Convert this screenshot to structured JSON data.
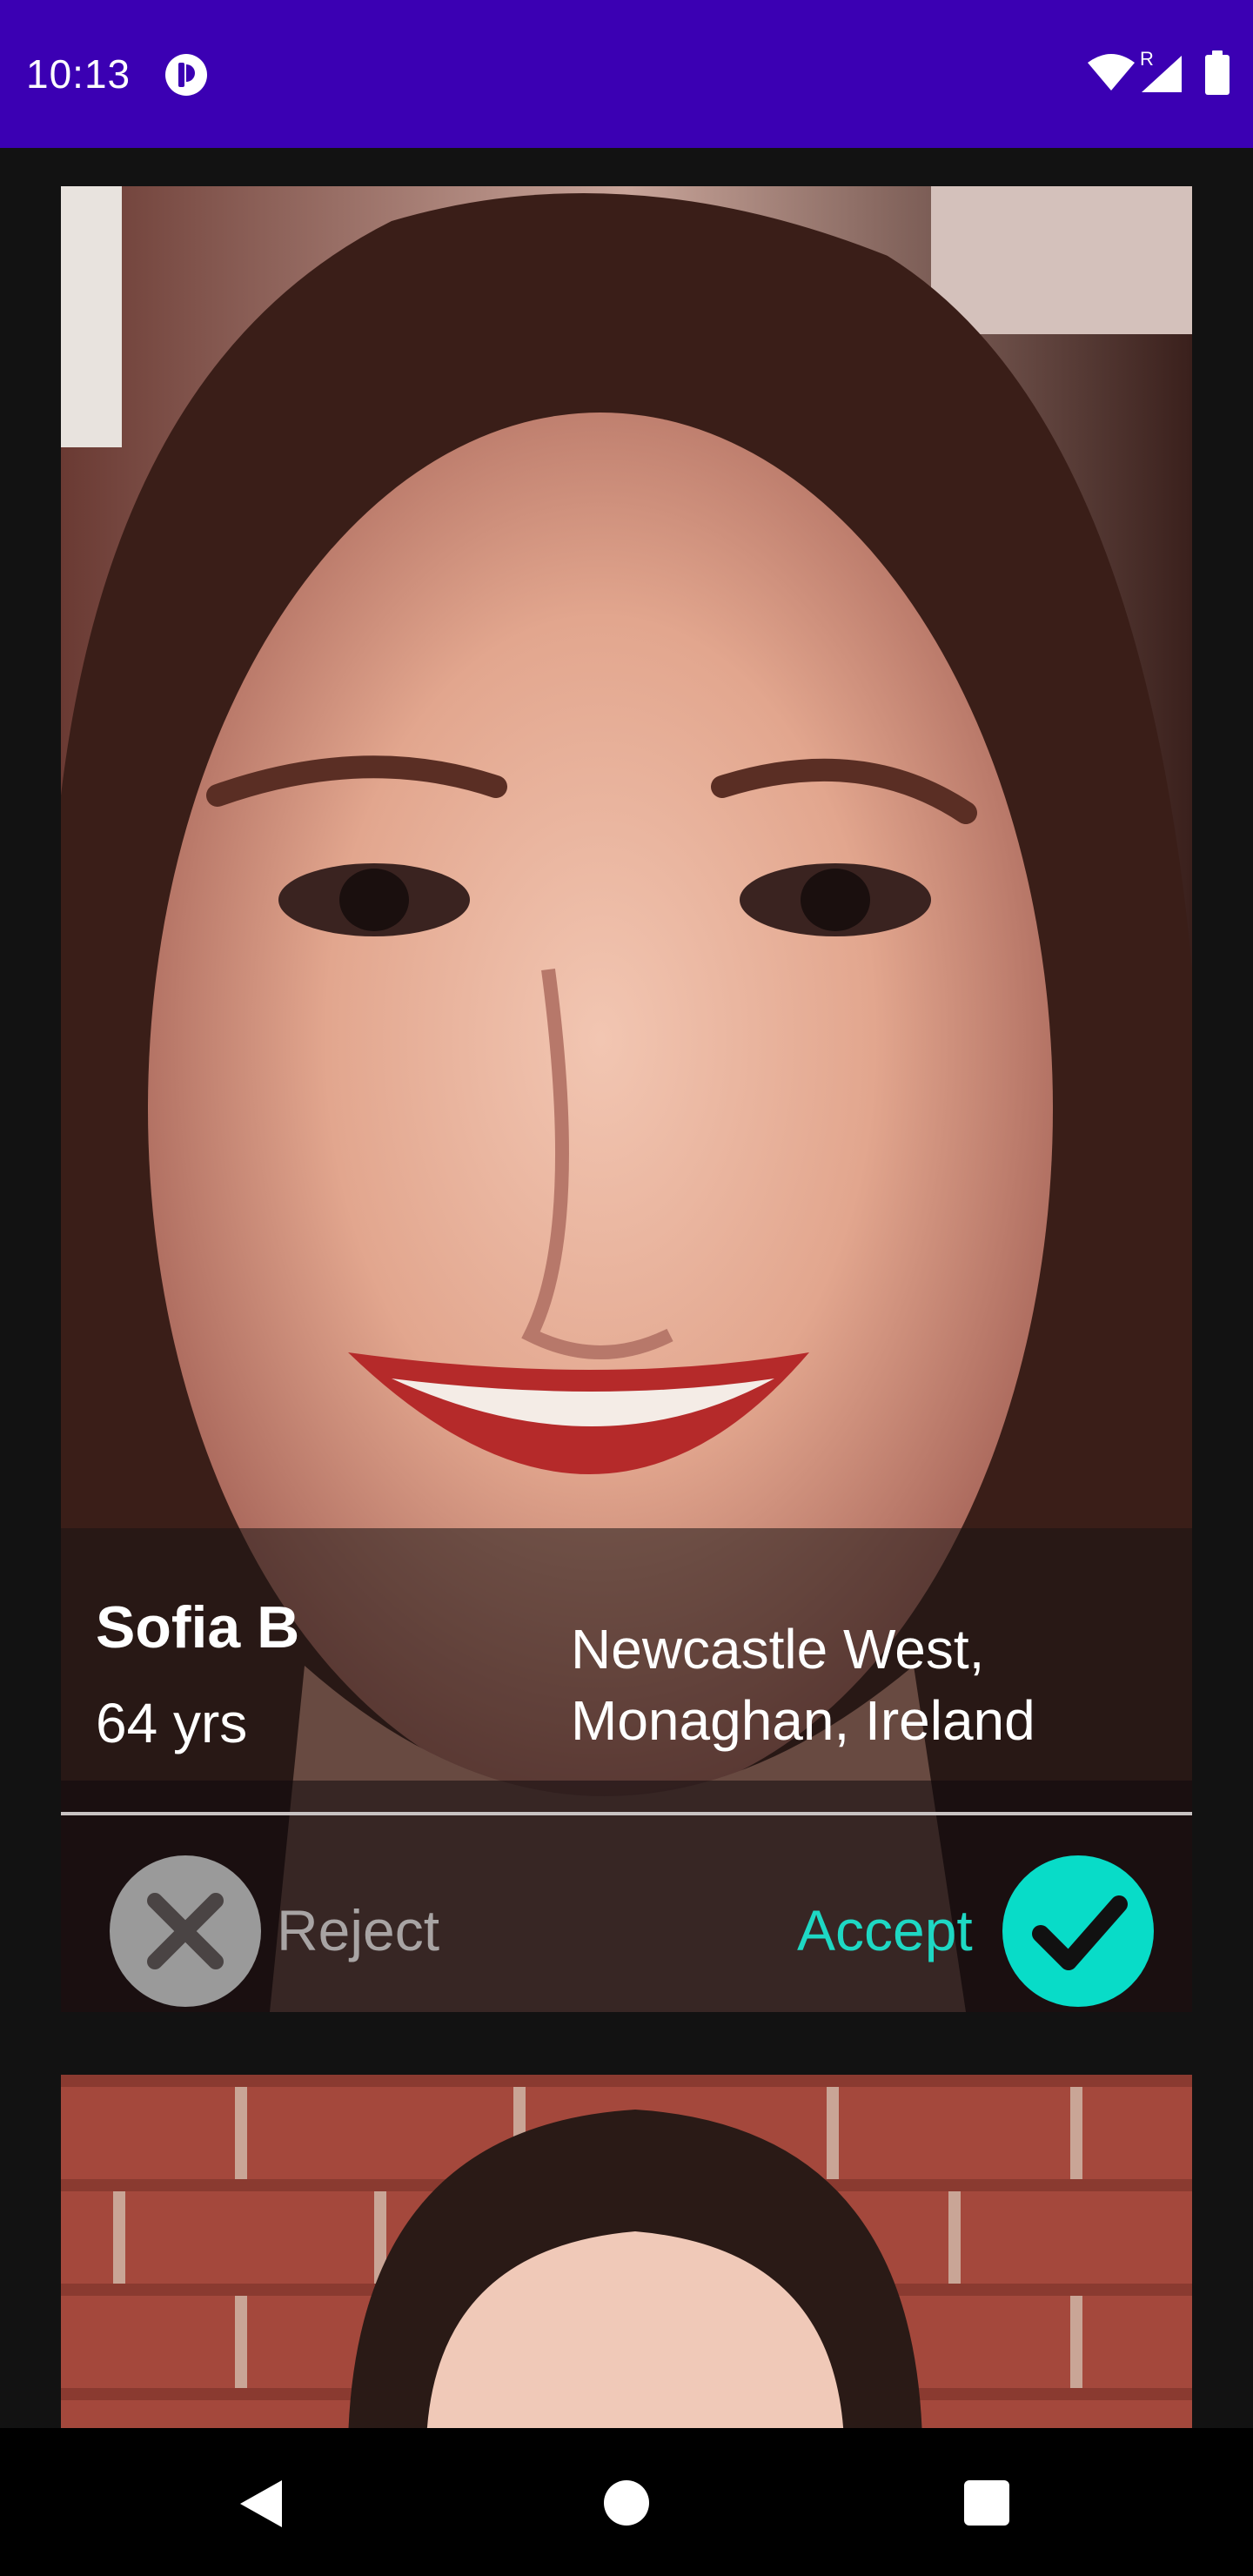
{
  "status_bar": {
    "time": "10:13",
    "roaming_indicator": "R",
    "background_color": "#3b00b3",
    "icons": [
      "app-notification-icon",
      "wifi-icon",
      "signal-icon",
      "battery-icon"
    ]
  },
  "cards": [
    {
      "name": "Sofia B",
      "age": "64 yrs",
      "location": "Newcastle West, Monaghan, Ireland",
      "reject_label": "Reject",
      "accept_label": "Accept",
      "reject_icon": "close-icon",
      "accept_icon": "check-icon"
    },
    {
      "partial": true
    }
  ],
  "colors": {
    "accent": "#1ed8c4",
    "accept_button": "#08dcc8",
    "reject_button": "#9a9a9a",
    "reject_text": "#a8a4a4",
    "background": "#121212"
  },
  "nav_bar": {
    "icons": [
      "back-icon",
      "home-icon",
      "recents-icon"
    ]
  }
}
